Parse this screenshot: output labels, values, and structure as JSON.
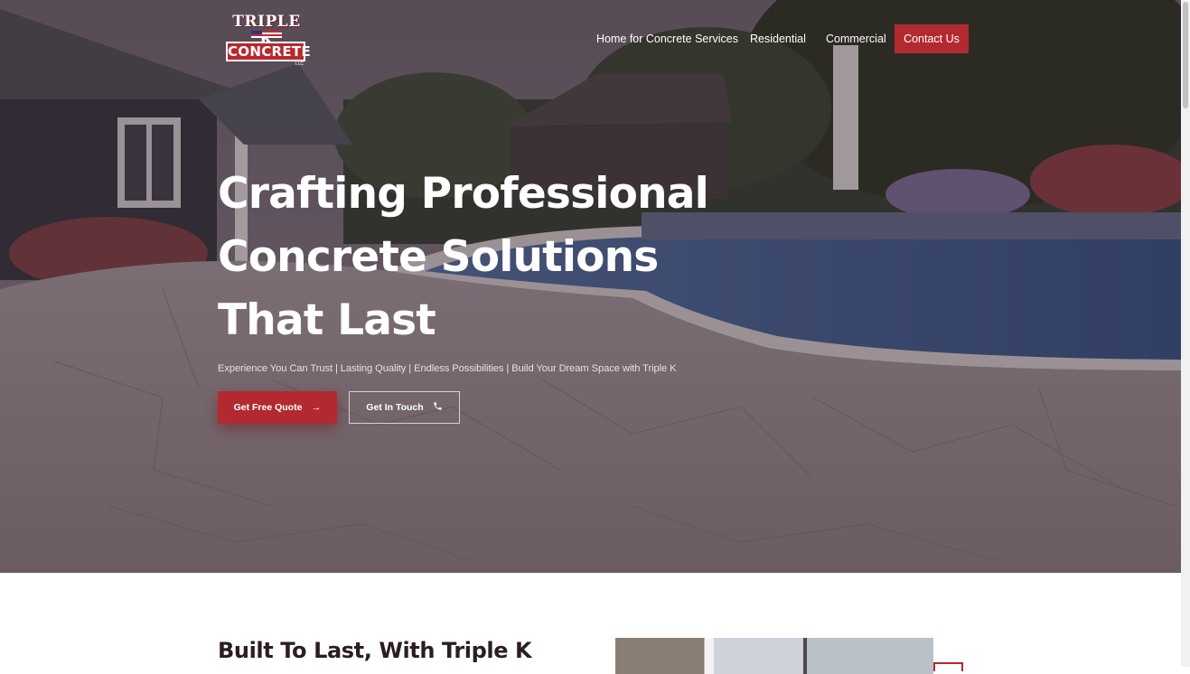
{
  "header": {
    "logo": {
      "line1": "TRIPLE K",
      "line2": "CONCRETE",
      "suffix": "LLC"
    },
    "nav": [
      {
        "label": "Home for Concrete Services"
      },
      {
        "label": "Residential"
      },
      {
        "label": "Commercial"
      }
    ],
    "contact_label": "Contact Us"
  },
  "hero": {
    "headline_lines": [
      "Crafting Professional",
      "Concrete Solutions",
      "That Last"
    ],
    "tagline": "Experience You Can Trust | Lasting Quality | Endless Possibilities | Build Your Dream Space with Triple K",
    "primary_button": {
      "label": "Get Free Quote",
      "icon": "arrow-right-icon"
    },
    "secondary_button": {
      "label": "Get In Touch",
      "icon": "phone-icon"
    }
  },
  "section": {
    "title": "Built To Last, With Triple K"
  },
  "colors": {
    "brand_red": "#b22a30",
    "hero_overlay": "#37262d",
    "heading_dark": "#2b1d22"
  }
}
